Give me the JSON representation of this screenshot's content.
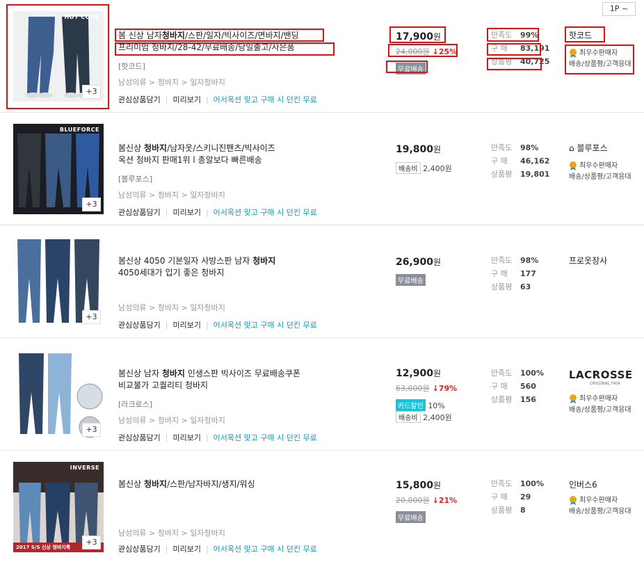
{
  "pager": {
    "label": "1P ~"
  },
  "labels": {
    "satisfaction": "만족도",
    "purchase": "구 매",
    "reviews": "상품평",
    "interest": "관심상품담기",
    "preview": "미리보기",
    "promo": "어서옥션 맞고 구매 시 던킨 무료",
    "free_ship": "무료배송",
    "ship_fee": "배송비",
    "card_discount": "카드할인",
    "power_seller": "최우수판매자",
    "seller_desc": "배송/상품평/고객응대",
    "more": "+3",
    "won": "원"
  },
  "products": [
    {
      "title1_pre": "봄 신상 남자",
      "title1_bold": "청바지",
      "title1_post": "/스판/일자/빅사이즈/면바지/밴딩",
      "title2": "프리미엄 청바지/28-42/무료배송/당일출고/사은품",
      "seller_tag": "[핫코드]",
      "category": "남성의류 > 청바지 > 일자청바지",
      "price": "17,900",
      "orig_price": "24,000원",
      "discount": "↓25%",
      "ship": "무료배송",
      "ship_fee": "",
      "satisfaction": "99%",
      "purchase": "83,191",
      "reviews": "40,725",
      "shop": "핫코드",
      "brand_mark": "HOT CODE"
    },
    {
      "title1_pre": "봄신상 ",
      "title1_bold": "청바지",
      "title1_post": "/남자옷/스키니진팬츠/빅사이즈",
      "title2": "옥션 청바지 판매1위 l 총알보다 빠른배송",
      "seller_tag": "[블루포스]",
      "category": "남성의류 > 청바지 > 일자청바지",
      "price": "19,800",
      "orig_price": "",
      "discount": "",
      "ship": "",
      "ship_fee": "2,400원",
      "satisfaction": "98%",
      "purchase": "46,162",
      "reviews": "19,801",
      "shop": "블루포스",
      "brand_mark": "BLUEFORCE"
    },
    {
      "title1_pre": "봄신상 4050 기본일자 사방스판 남자 ",
      "title1_bold": "청바지",
      "title1_post": "",
      "title2": "4050세대가 입기 좋은 청바지",
      "seller_tag": "",
      "category": "남성의류 > 청바지 > 일자청바지",
      "price": "26,900",
      "orig_price": "",
      "discount": "",
      "ship": "무료배송",
      "ship_fee": "",
      "satisfaction": "98%",
      "purchase": "177",
      "reviews": "63",
      "shop": "프로옷장사",
      "brand_mark": ""
    },
    {
      "title1_pre": "봄신상 남자 ",
      "title1_bold": "청바지",
      "title1_post": " 인생스판 빅사이즈 무료배송쿠폰",
      "title2": "비교불가 고퀄리티 청바지",
      "seller_tag": "[라크로스]",
      "category": "남성의류 > 청바지 > 일자청바지",
      "price": "12,900",
      "orig_price": "63,000원",
      "discount": "↓79%",
      "card_pct": "10%",
      "ship": "",
      "ship_fee": "2,400원",
      "satisfaction": "100%",
      "purchase": "560",
      "reviews": "156",
      "shop": "LACROSSE",
      "shop_sub": "ORIGINAL FAIA",
      "brand_mark": ""
    },
    {
      "title1_pre": "봄신상 ",
      "title1_bold": "청바지",
      "title1_post": "/스판/남자바지/생지/워싱",
      "title2": "",
      "seller_tag": "",
      "category": "남성의류 > 청바지 > 일자청바지",
      "price": "15,800",
      "orig_price": "20,000원",
      "discount": "↓21%",
      "ship": "무료배송",
      "ship_fee": "",
      "satisfaction": "100%",
      "purchase": "29",
      "reviews": "8",
      "shop": "인버스6",
      "brand_mark": "INVERSE",
      "banner": "2017 S/S 신상 청바지룩"
    }
  ],
  "colors": {
    "accent_red": "#e01010",
    "promo_teal": "#0f9ab8",
    "discount_red": "#e02020",
    "free_ship_gray": "#8a8f99"
  }
}
